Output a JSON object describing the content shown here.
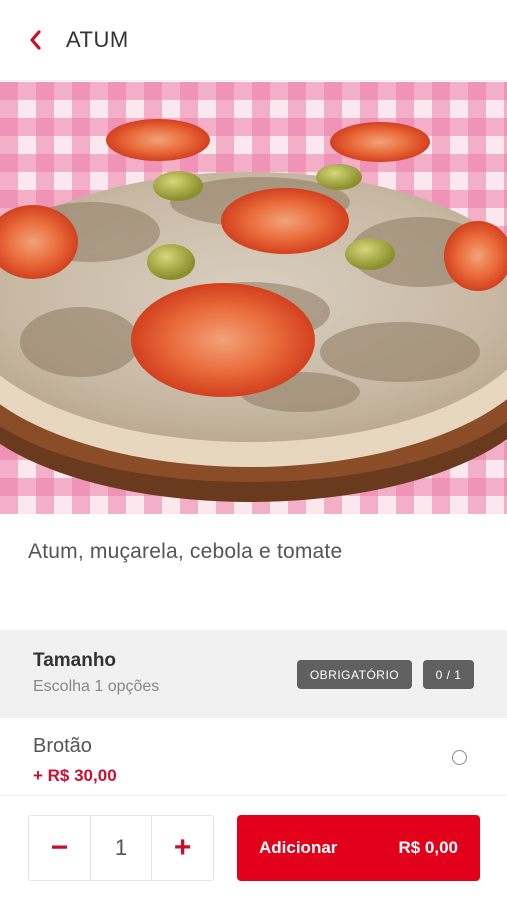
{
  "header": {
    "title": "ATUM"
  },
  "product": {
    "description": "Atum, muçarela, cebola e tomate"
  },
  "section": {
    "title": "Tamanho",
    "subtitle": "Escolha 1 opções",
    "required_badge": "OBRIGATÓRIO",
    "count_badge": "0 / 1"
  },
  "options": [
    {
      "name": "Brotão",
      "price": "+ R$ 30,00",
      "selected": false
    }
  ],
  "footer": {
    "minus": "−",
    "quantity": "1",
    "plus": "+",
    "add_label": "Adicionar",
    "add_price": "R$ 0,00"
  },
  "colors": {
    "accent": "#e3001b",
    "price": "#c8102e",
    "badge": "#606060"
  },
  "icons": {
    "back": "chevron-left-icon",
    "radio": "radio-unchecked-icon"
  }
}
